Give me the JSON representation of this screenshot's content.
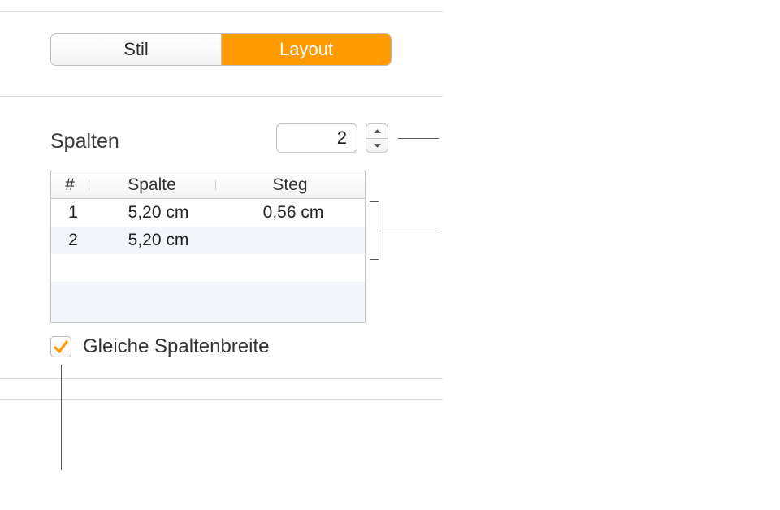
{
  "tabs": {
    "stil": {
      "label": "Stil",
      "active": false
    },
    "layout": {
      "label": "Layout",
      "active": true
    }
  },
  "columns": {
    "label": "Spalten",
    "count": "2"
  },
  "table": {
    "headers": {
      "index": "#",
      "column": "Spalte",
      "gutter": "Steg"
    },
    "rows": [
      {
        "index": "1",
        "column": "5,20 cm",
        "gutter": "0,56 cm"
      },
      {
        "index": "2",
        "column": "5,20 cm",
        "gutter": ""
      }
    ]
  },
  "equalWidth": {
    "label": "Gleiche Spaltenbreite",
    "checked": true
  },
  "colors": {
    "accent": "#ff9a00"
  }
}
